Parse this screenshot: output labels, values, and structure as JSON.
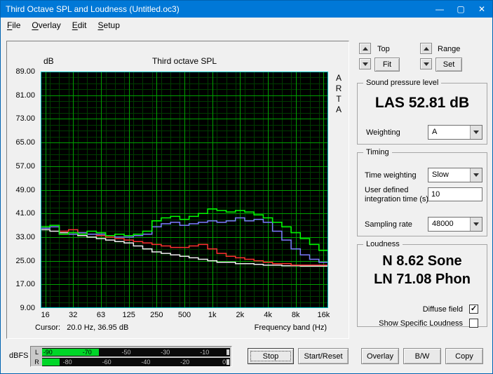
{
  "window": {
    "title": "Third Octave SPL and Loudness (Untitled.oc3)",
    "controls": {
      "minimize": "—",
      "maximize": "▢",
      "close": "✕"
    }
  },
  "icons": {
    "check_glyph": "✓"
  },
  "menu": {
    "items": [
      {
        "label": "File",
        "underline": 0
      },
      {
        "label": "Overlay",
        "underline": 0
      },
      {
        "label": "Edit",
        "underline": 0
      },
      {
        "label": "Setup",
        "underline": 0
      }
    ]
  },
  "chart": {
    "title": "Third octave SPL",
    "y_unit_label": "dB",
    "watermark": "ARTA",
    "y_ticks": [
      "89.00",
      "81.00",
      "73.00",
      "65.00",
      "57.00",
      "49.00",
      "41.00",
      "33.00",
      "25.00",
      "17.00",
      "9.00"
    ],
    "x_ticks": [
      "16",
      "32",
      "63",
      "125",
      "250",
      "500",
      "1k",
      "2k",
      "4k",
      "8k",
      "16k"
    ],
    "cursor_text": "Cursor:   20.0 Hz, 36.95 dB",
    "x_axis_label": "Frequency band (Hz)"
  },
  "chart_data": {
    "type": "bar",
    "subtype": "third-octave-step-lines",
    "title": "Third octave SPL",
    "xlabel": "Frequency band (Hz)",
    "ylabel": "dB",
    "ylim": [
      9,
      89
    ],
    "y_major_step": 8,
    "y_minor_step": 2,
    "grid": true,
    "background": "#000000",
    "grid_major_color": "#00a000",
    "grid_minor_color": "#003c00",
    "frame_color": "#00c8c8",
    "cursor": {
      "freq_hz": 20.0,
      "value_db": 36.95
    },
    "categories": [
      "16",
      "20",
      "25",
      "31.5",
      "40",
      "50",
      "63",
      "80",
      "100",
      "125",
      "160",
      "200",
      "250",
      "315",
      "400",
      "500",
      "630",
      "800",
      "1k",
      "1.25k",
      "1.6k",
      "2k",
      "2.5k",
      "3.15k",
      "4k",
      "5k",
      "6.3k",
      "8k",
      "10k",
      "12.5k",
      "16k"
    ],
    "series": [
      {
        "name": "white",
        "color": "#f0f0f0",
        "values": [
          35.5,
          35.0,
          34.5,
          34.0,
          33.5,
          33.0,
          32.5,
          32.0,
          31.5,
          31.0,
          30.0,
          29.0,
          28.0,
          27.5,
          27.0,
          26.5,
          26.0,
          25.5,
          25.0,
          24.5,
          24.5,
          24.0,
          24.0,
          23.8,
          23.5,
          23.5,
          23.3,
          23.3,
          23.2,
          23.2,
          23.2
        ]
      },
      {
        "name": "red",
        "color": "#ff3030",
        "values": [
          36.0,
          36.5,
          35.0,
          35.5,
          34.5,
          34.0,
          33.5,
          33.0,
          32.5,
          32.0,
          31.5,
          31.0,
          30.5,
          30.0,
          29.5,
          29.5,
          30.0,
          30.5,
          29.0,
          27.5,
          26.5,
          26.0,
          25.5,
          25.0,
          24.5,
          24.0,
          24.0,
          23.5,
          23.5,
          23.5,
          23.5
        ]
      },
      {
        "name": "blue",
        "color": "#7b7bff",
        "values": [
          36.0,
          36.5,
          34.0,
          34.0,
          34.5,
          34.0,
          34.0,
          33.5,
          33.0,
          33.0,
          33.5,
          34.0,
          36.5,
          37.5,
          38.0,
          37.0,
          37.5,
          38.0,
          38.5,
          38.0,
          38.5,
          39.5,
          38.5,
          39.0,
          38.0,
          35.0,
          32.0,
          29.0,
          27.0,
          25.5,
          24.5
        ]
      },
      {
        "name": "green",
        "color": "#00ff00",
        "values": [
          36.5,
          37.0,
          34.0,
          34.5,
          34.0,
          35.0,
          34.5,
          33.5,
          34.0,
          33.5,
          34.0,
          35.0,
          38.5,
          39.5,
          40.0,
          39.0,
          40.0,
          41.0,
          42.5,
          42.0,
          41.5,
          42.0,
          41.5,
          40.5,
          39.5,
          38.0,
          36.5,
          34.5,
          32.5,
          30.5,
          28.5
        ]
      }
    ]
  },
  "controls_top": {
    "top_label": "Top",
    "fit_button": "Fit",
    "range_label": "Range",
    "set_button": "Set"
  },
  "spl_group": {
    "title": "Sound pressure level",
    "value": "LAS 52.81 dB",
    "weighting_label": "Weighting",
    "weighting_value": "A"
  },
  "timing_group": {
    "title": "Timing",
    "time_weighting_label": "Time weighting",
    "time_weighting_value": "Slow",
    "integration_label_1": "User defined",
    "integration_label_2": "integration time (s)",
    "integration_value": "10",
    "sampling_label": "Sampling rate",
    "sampling_value": "48000"
  },
  "loudness_group": {
    "title": "Loudness",
    "n_value": "N 8.62 Sone",
    "ln_value": "LN 71.08 Phon",
    "diffuse_label": "Diffuse field",
    "diffuse_checked": true,
    "specific_label": "Show Specific Loudness",
    "specific_checked": false
  },
  "meter": {
    "label": "dBFS",
    "range": [
      -93,
      3
    ],
    "rows": [
      {
        "channel": "L",
        "ticks": [
          -90,
          -70,
          -50,
          -30,
          -10
        ],
        "peak": -64
      },
      {
        "channel": "R",
        "ticks": [
          -80,
          -60,
          -40,
          -20,
          0
        ],
        "peak": -84
      }
    ]
  },
  "bottom_buttons": {
    "stop": "Stop",
    "start_reset": "Start/Reset",
    "overlay": "Overlay",
    "bw": "B/W",
    "copy": "Copy"
  }
}
